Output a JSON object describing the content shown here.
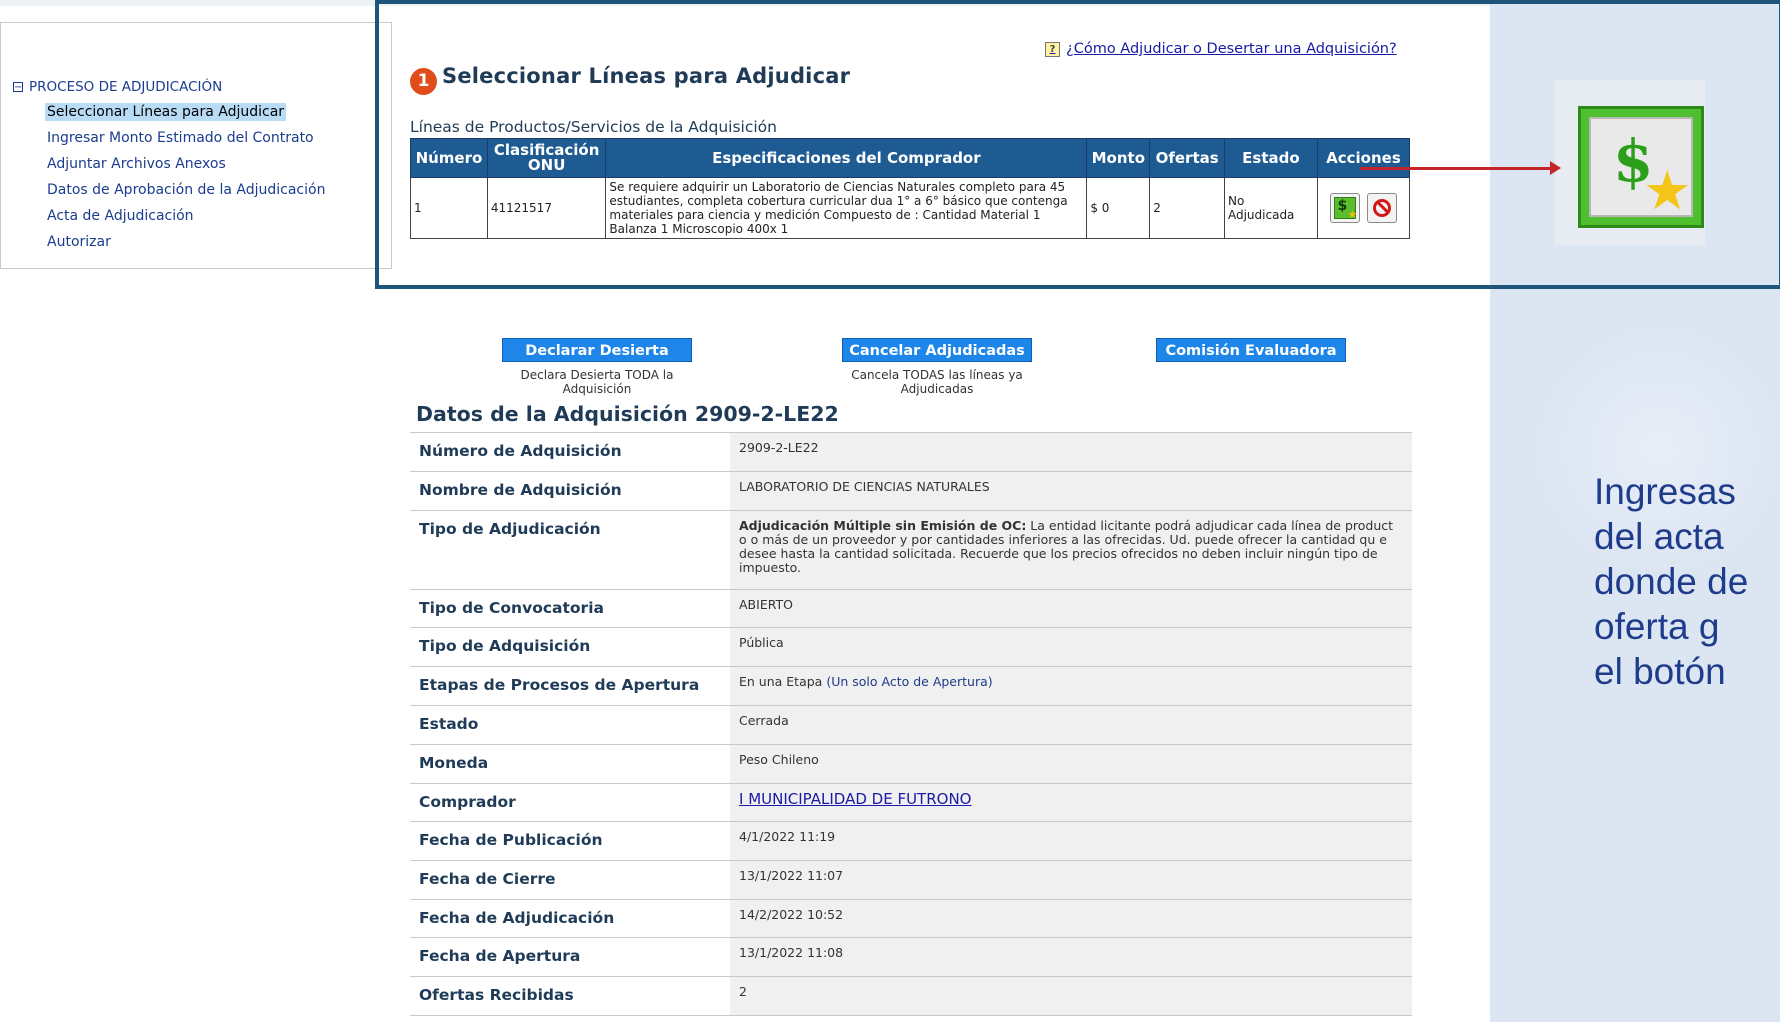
{
  "tree": {
    "root_label": "PROCESO DE ADJUDICACIÓN",
    "items": [
      {
        "label": "Seleccionar Líneas para Adjudicar",
        "selected": true
      },
      {
        "label": "Ingresar Monto Estimado del Contrato"
      },
      {
        "label": "Adjuntar Archivos Anexos"
      },
      {
        "label": "Datos de Aprobación de la Adjudicación"
      },
      {
        "label": "Acta de Adjudicación"
      },
      {
        "label": "Autorizar"
      }
    ]
  },
  "help_link": "¿Cómo Adjudicar o Desertar una Adquisición?",
  "step_number": "1",
  "page_title": "Seleccionar Líneas para Adjudicar",
  "lines_section_label": "Líneas de Productos/Servicios de la Adquisición",
  "lines_table": {
    "headers": [
      "Número",
      "Clasificación ONU",
      "Especificaciones del Comprador",
      "Monto",
      "Ofertas",
      "Estado",
      "Acciones"
    ],
    "row": {
      "numero": "1",
      "onu": "41121517",
      "spec": "Se requiere adquirir un Laboratorio de Ciencias Naturales completo para 45 estudiantes, completa cobertura curricular dua 1° a 6° básico que contenga materiales para ciencia y medición Compuesto de : Cantidad Material 1 Balanza 1 Microscopio 400x 1",
      "monto": "$ 0",
      "ofertas": "2",
      "estado_line1": "No",
      "estado_line2": "Adjudicada"
    }
  },
  "actions": {
    "declarar": {
      "label": "Declarar Desierta",
      "desc": "Declara Desierta TODA la Adquisición"
    },
    "cancelar": {
      "label": "Cancelar Adjudicadas",
      "desc": "Cancela TODAS las líneas ya Adjudicadas"
    },
    "comision": {
      "label": "Comisión Evaluadora"
    }
  },
  "data_title": "Datos de la Adquisición 2909-2-LE22",
  "details": {
    "numero": {
      "label": "Número de Adquisición",
      "value": "2909-2-LE22"
    },
    "nombre": {
      "label": "Nombre de Adquisición",
      "value": "LABORATORIO DE CIENCIAS NATURALES"
    },
    "tipo_adj": {
      "label": "Tipo de Adjudicación",
      "value_bold": "Adjudicación Múltiple sin Emisión de OC:",
      "value": " La entidad licitante podrá adjudicar cada línea de product o o más de un proveedor y por cantidades inferiores a las ofrecidas. Ud. puede ofrecer la cantidad qu e desee hasta la cantidad solicitada. Recuerde que los precios ofrecidos no deben incluir ningún tipo de impuesto."
    },
    "convocatoria": {
      "label": "Tipo de Convocatoria",
      "value": "ABIERTO"
    },
    "tipo_adq": {
      "label": "Tipo de Adquisición",
      "value": "Pública"
    },
    "etapas": {
      "label": "Etapas de Procesos de Apertura",
      "value": "En una Etapa",
      "value_extra": "(Un solo Acto de Apertura)"
    },
    "estado": {
      "label": "Estado",
      "value": "Cerrada"
    },
    "moneda": {
      "label": "Moneda",
      "value": "Peso Chileno"
    },
    "comprador": {
      "label": "Comprador",
      "value": "I MUNICIPALIDAD DE FUTRONO"
    },
    "publicacion": {
      "label": "Fecha de Publicación",
      "value": "4/1/2022 11:19"
    },
    "cierre": {
      "label": "Fecha de Cierre",
      "value": "13/1/2022 11:07"
    },
    "adjudicacion": {
      "label": "Fecha de Adjudicación",
      "value": "14/2/2022 10:52"
    },
    "apertura": {
      "label": "Fecha de Apertura",
      "value": "13/1/2022 11:08"
    },
    "ofertas": {
      "label": "Ofertas Recibidas",
      "value": "2"
    }
  },
  "side_text": [
    "Ingresas",
    "del acta",
    "donde de",
    "oferta g",
    "el botón"
  ],
  "colors": {
    "header_blue": "#1e5b93",
    "button_blue": "#1e86e8",
    "frame": "#1e5679",
    "arrow": "#c4252a",
    "estado": "#f0a020"
  }
}
